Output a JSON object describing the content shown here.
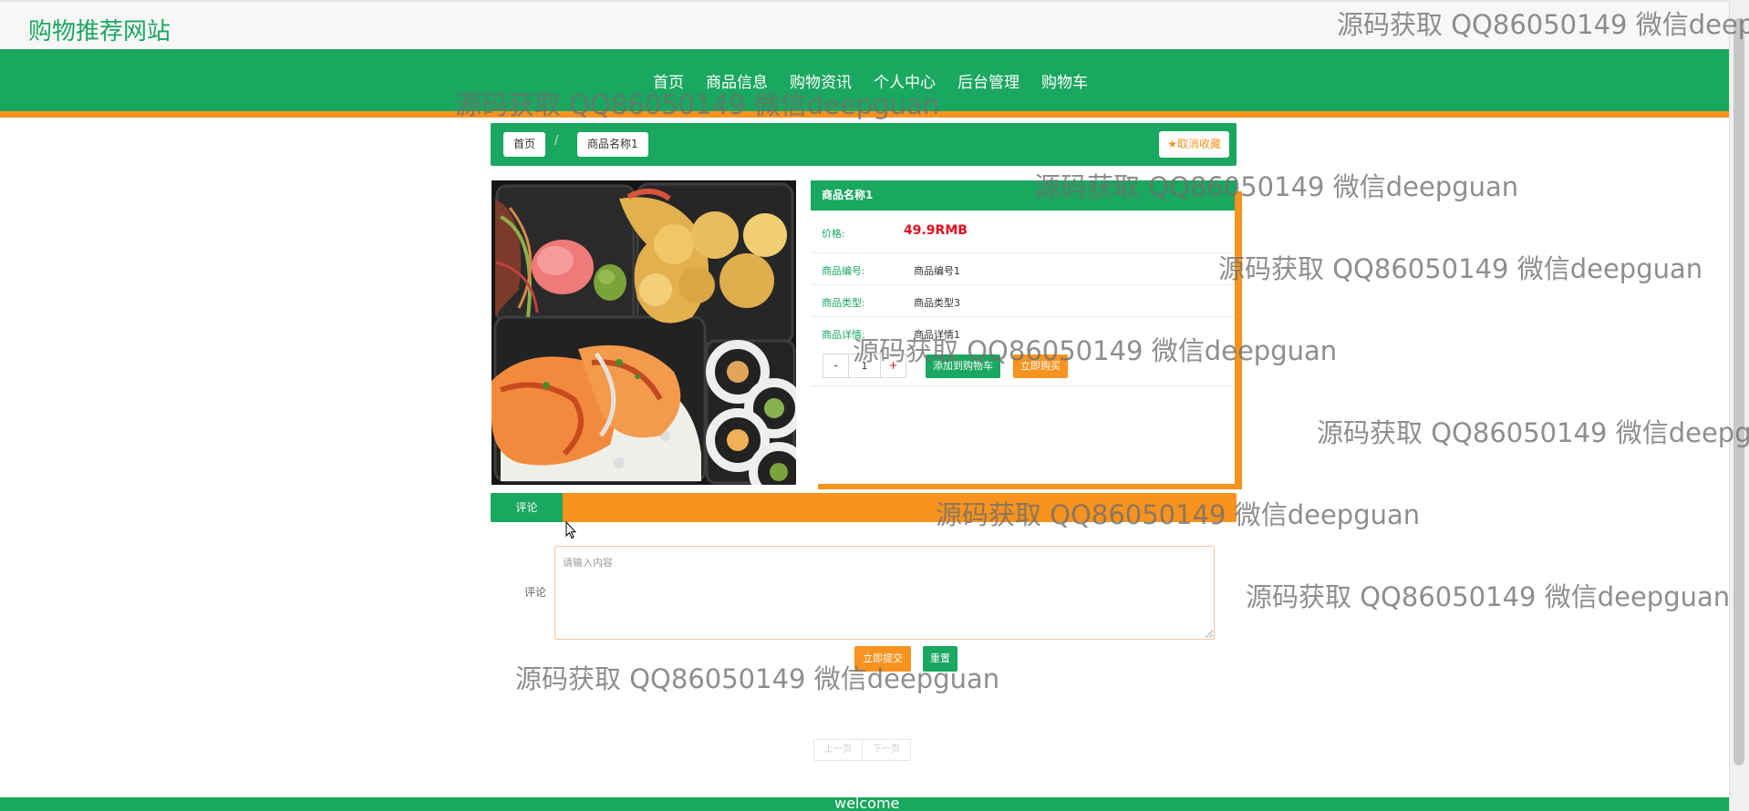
{
  "site": {
    "title": "购物推荐网站"
  },
  "nav": {
    "items": [
      {
        "label": "首页"
      },
      {
        "label": "商品信息"
      },
      {
        "label": "购物资讯"
      },
      {
        "label": "个人中心"
      },
      {
        "label": "后台管理"
      },
      {
        "label": "购物车"
      }
    ]
  },
  "breadcrumb": {
    "home": "首页",
    "separator": "/",
    "current": "商品名称1"
  },
  "favorite": {
    "icon": "star-icon",
    "label": "取消收藏"
  },
  "product": {
    "name": "商品名称1",
    "price_label": "价格:",
    "price": "49.9RMB",
    "fields": [
      {
        "label": "商品编号:",
        "value": "商品编号1"
      },
      {
        "label": "商品类型:",
        "value": "商品类型3"
      },
      {
        "label": "商品详情:",
        "value": "商品详情1"
      }
    ],
    "quantity": {
      "minus": "-",
      "value": "1",
      "plus": "+"
    },
    "add_to_cart": "添加到购物车",
    "buy_now": "立即购买"
  },
  "comments": {
    "tab": "评论",
    "form_label": "评论",
    "placeholder": "请输入内容",
    "submit": "立即提交",
    "reset": "重置"
  },
  "pager": {
    "prev": "上一页",
    "next": "下一页"
  },
  "footer": {
    "text": "welcome"
  },
  "watermark": {
    "text": "源码获取 QQ86050149 微信deepguan"
  },
  "colors": {
    "primary_green": "#1aa75f",
    "accent_orange": "#f7931e",
    "price_red": "#e10f1f"
  }
}
